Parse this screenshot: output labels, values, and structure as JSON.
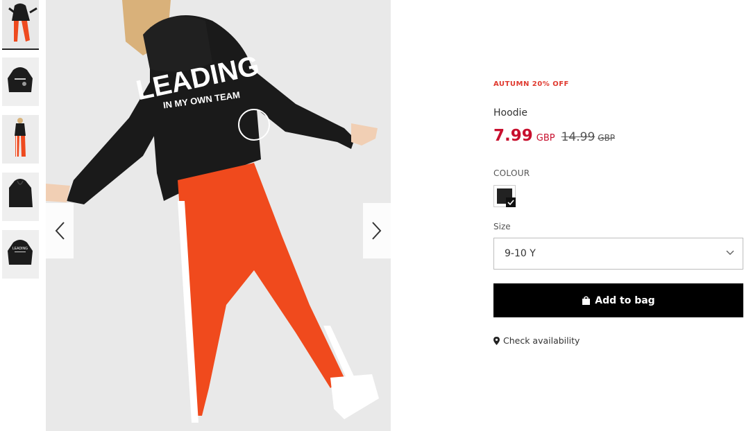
{
  "gallery": {
    "thumbnails": [
      {
        "name": "thumbnail-1",
        "active": true
      },
      {
        "name": "thumbnail-2",
        "active": false
      },
      {
        "name": "thumbnail-3",
        "active": false
      },
      {
        "name": "thumbnail-4",
        "active": false
      },
      {
        "name": "thumbnail-5",
        "active": false
      }
    ],
    "main_image_print_top": "LEADING",
    "main_image_print_sub": "IN MY OWN TEAM",
    "prev_icon": "chevron-left-icon",
    "next_icon": "chevron-right-icon"
  },
  "product": {
    "promo": "AUTUMN 20% OFF",
    "name": "Hoodie",
    "price_now": "7.99",
    "price_now_currency": "GBP",
    "price_old": "14.99",
    "price_old_currency": "GBP",
    "colour_label": "COLOUR",
    "selected_colour": "#222222",
    "size_label": "Size",
    "selected_size": "9-10 Y",
    "add_to_bag": "Add to bag",
    "check_availability": "Check availability"
  },
  "colors": {
    "promo": "#e03a2f",
    "price": "#c8102e",
    "button": "#000000"
  }
}
